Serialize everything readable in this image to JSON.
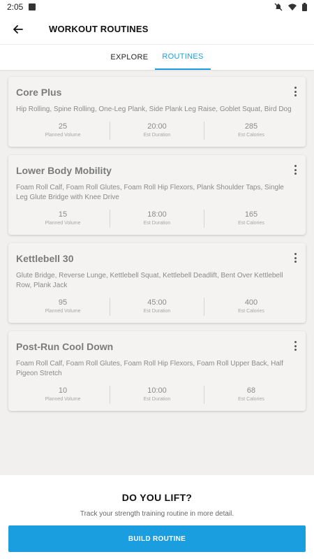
{
  "status_bar": {
    "time": "2:05"
  },
  "header": {
    "title": "WORKOUT ROUTINES"
  },
  "tabs": [
    {
      "label": "EXPLORE",
      "active": false
    },
    {
      "label": "ROUTINES",
      "active": true
    }
  ],
  "routines": [
    {
      "name": "Core Plus",
      "exercises": "Hip Rolling, Spine Rolling, One-Leg Plank, Side Plank Leg Raise, Goblet Squat, Bird Dog",
      "stats": [
        {
          "value": "25",
          "label": "Planned Volume"
        },
        {
          "value": "20:00",
          "label": "Est Duration"
        },
        {
          "value": "285",
          "label": "Est Calories"
        }
      ]
    },
    {
      "name": "Lower Body Mobility",
      "exercises": "Foam Roll Calf, Foam Roll Glutes, Foam Roll Hip Flexors, Plank Shoulder Taps, Single Leg Glute Bridge with Knee Drive",
      "stats": [
        {
          "value": "15",
          "label": "Planned Volume"
        },
        {
          "value": "18:00",
          "label": "Est Duration"
        },
        {
          "value": "165",
          "label": "Est Calories"
        }
      ]
    },
    {
      "name": "Kettlebell 30",
      "exercises": "Glute Bridge, Reverse Lunge, Kettlebell Squat, Kettlebell Deadlift, Bent Over Kettlebell Row, Plank Jack",
      "stats": [
        {
          "value": "95",
          "label": "Planned Volume"
        },
        {
          "value": "45:00",
          "label": "Est Duration"
        },
        {
          "value": "400",
          "label": "Est Calories"
        }
      ]
    },
    {
      "name": "Post-Run Cool Down",
      "exercises": "Foam Roll Calf, Foam Roll Glutes, Foam Roll Hip Flexors, Foam Roll Upper Back, Half Pigeon Stretch",
      "stats": [
        {
          "value": "10",
          "label": "Planned Volume"
        },
        {
          "value": "10:00",
          "label": "Est Duration"
        },
        {
          "value": "68",
          "label": "Est Calories"
        }
      ]
    }
  ],
  "promo": {
    "title": "DO YOU LIFT?",
    "subtitle": "Track your strength training routine in more detail.",
    "button_label": "BUILD ROUTINE"
  },
  "colors": {
    "accent": "#1a9ee0"
  }
}
